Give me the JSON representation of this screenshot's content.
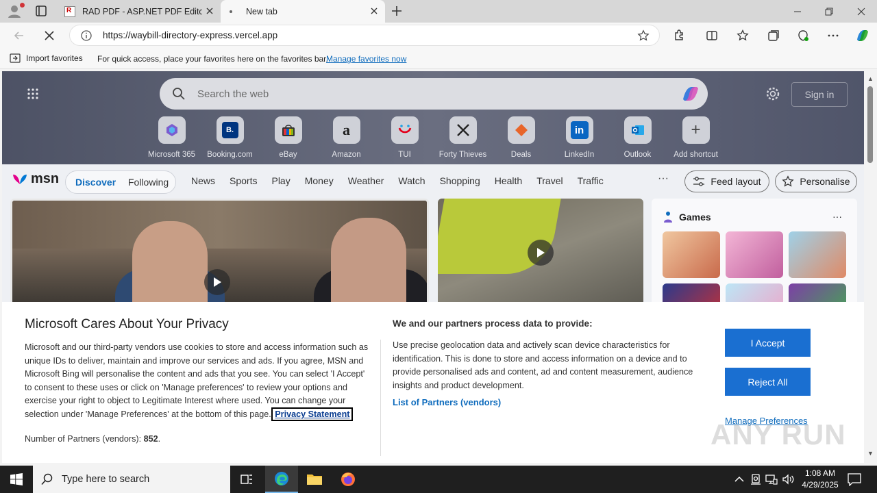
{
  "browser": {
    "tabs": [
      {
        "title": "RAD PDF - ASP.NET PDF Editor and",
        "icon": "rad-pdf-favicon"
      },
      {
        "title": "New tab",
        "icon": "loading-dot"
      }
    ],
    "url": "https://waybill-directory-express.vercel.app",
    "favorites_bar": {
      "import_label": "Import favorites",
      "hint": "For quick access, place your favorites here on the favorites bar.",
      "manage_link": "Manage favorites now"
    }
  },
  "newtab": {
    "search_placeholder": "Search the web",
    "signin_label": "Sign in",
    "shortcuts": [
      {
        "label": "Microsoft 365",
        "icon": "m365-icon"
      },
      {
        "label": "Booking.com",
        "icon": "booking-icon",
        "glyph": "B."
      },
      {
        "label": "eBay",
        "icon": "ebay-icon"
      },
      {
        "label": "Amazon",
        "icon": "amazon-icon",
        "glyph": "a"
      },
      {
        "label": "TUI",
        "icon": "tui-icon"
      },
      {
        "label": "Forty Thieves",
        "icon": "forty-thieves-icon"
      },
      {
        "label": "Deals",
        "icon": "deals-icon"
      },
      {
        "label": "LinkedIn",
        "icon": "linkedin-icon",
        "glyph": "in"
      },
      {
        "label": "Outlook",
        "icon": "outlook-icon"
      },
      {
        "label": "Add shortcut",
        "icon": "plus-icon",
        "glyph": "+"
      }
    ]
  },
  "msn": {
    "logo": "msn",
    "toggle": {
      "discover": "Discover",
      "following": "Following"
    },
    "nav": [
      "News",
      "Sports",
      "Play",
      "Money",
      "Weather",
      "Watch",
      "Shopping",
      "Health",
      "Travel",
      "Traffic"
    ],
    "more": "···",
    "feed_layout": "Feed layout",
    "personalise": "Personalise",
    "games_title": "Games",
    "games_more": "···"
  },
  "privacy": {
    "title": "Microsoft Cares About Your Privacy",
    "body": "Microsoft and our third-party vendors use cookies to store and access information such as unique IDs to deliver, maintain and improve our services and ads. If you agree, MSN and Microsoft Bing will personalise the content and ads that you see. You can select 'I Accept' to consent to these uses or click on 'Manage preferences' to review your options and exercise your right to object to Legitimate Interest where used.  You can change your selection under 'Manage Preferences' at the bottom of this page.",
    "privacy_link": "Privacy Statement",
    "partners_label": "Number of Partners (vendors):",
    "partners_count": "852",
    "partners_suffix": ".",
    "heading2": "We and our partners process data to provide:",
    "body2": "Use precise geolocation data and actively scan device characteristics for identification. This is done to store and access information on a device and to provide personalised ads and content, ad and content measurement, audience insights and product development.",
    "list_link": "List of Partners (vendors)",
    "accept": "I Accept",
    "reject": "Reject All",
    "manage": "Manage Preferences"
  },
  "watermark": "ANY RUN",
  "taskbar": {
    "search_placeholder": "Type here to search",
    "time": "1:08 AM",
    "date": "4/29/2025"
  },
  "colors": {
    "accent": "#1a6fd1",
    "link": "#0f6cbd"
  }
}
